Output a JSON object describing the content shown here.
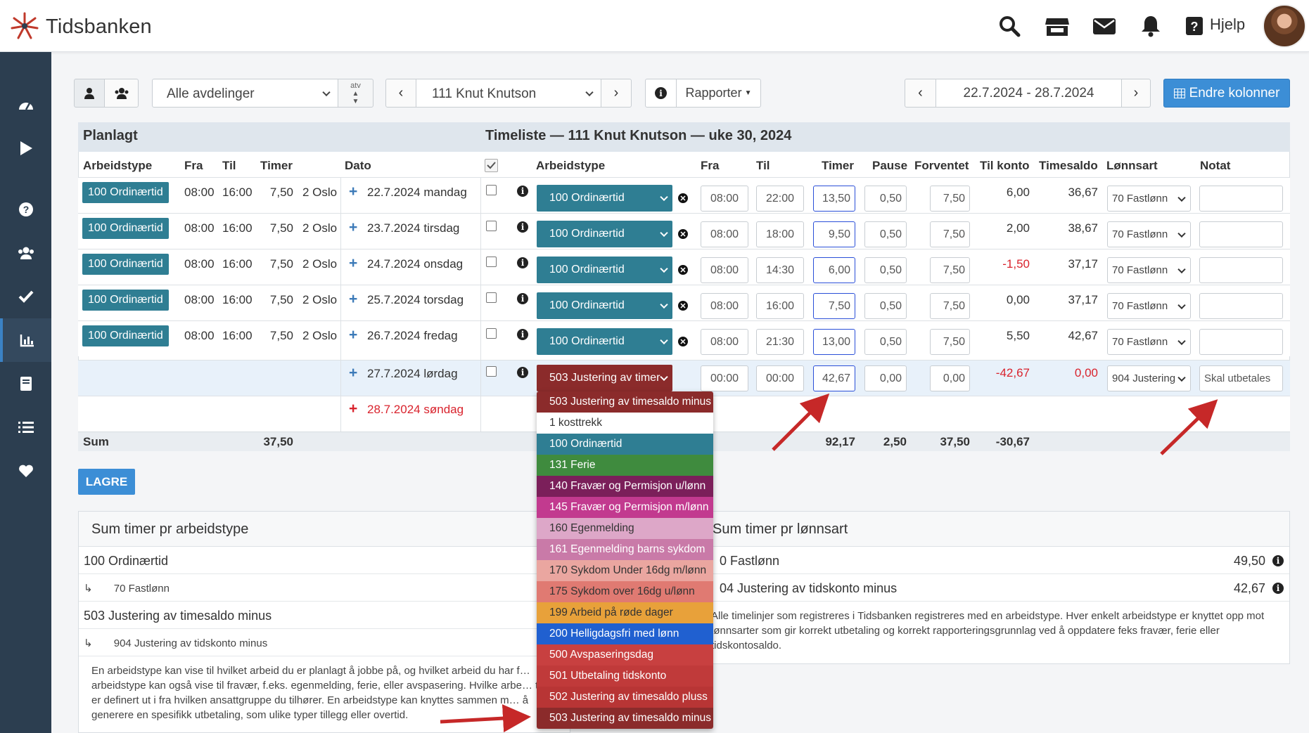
{
  "app": {
    "name": "Tidsbanken"
  },
  "header": {
    "help_label": "Hjelp"
  },
  "toolbar": {
    "department": "Alle avdelinger",
    "atv": "atv",
    "employee": "111 Knut Knutson",
    "reports_label": "Rapporter",
    "date_range": "22.7.2024 - 28.7.2024",
    "edit_columns_label": "Endre kolonner"
  },
  "panel": {
    "planned_title": "Planlagt",
    "timesheet_title": "Timeliste — 111 Knut Knutson — uke 30, 2024",
    "planned_columns": [
      "Arbeidstype",
      "Fra",
      "Til",
      "Timer"
    ],
    "date_column": "Dato",
    "columns": [
      "Arbeidstype",
      "Fra",
      "Til",
      "Timer",
      "Pause",
      "Forventet",
      "Til konto",
      "Timesaldo",
      "Lønnsart",
      "Notat"
    ],
    "rows": [
      {
        "planned_type": "100 Ordinærtid",
        "p_from": "08:00",
        "p_to": "16:00",
        "p_hours": "7,50",
        "dept": "2 Oslo",
        "date": "22.7.2024 mandag",
        "type": "100 Ordinærtid",
        "from": "08:00",
        "to": "22:00",
        "hours": "13,50",
        "pause": "0,50",
        "expected": "7,50",
        "to_account": "6,00",
        "balance": "36,67",
        "wage": "70 Fastlønn",
        "note": ""
      },
      {
        "planned_type": "100 Ordinærtid",
        "p_from": "08:00",
        "p_to": "16:00",
        "p_hours": "7,50",
        "dept": "2 Oslo",
        "date": "23.7.2024 tirsdag",
        "type": "100 Ordinærtid",
        "from": "08:00",
        "to": "18:00",
        "hours": "9,50",
        "pause": "0,50",
        "expected": "7,50",
        "to_account": "2,00",
        "balance": "38,67",
        "wage": "70 Fastlønn",
        "note": ""
      },
      {
        "planned_type": "100 Ordinærtid",
        "p_from": "08:00",
        "p_to": "16:00",
        "p_hours": "7,50",
        "dept": "2 Oslo",
        "date": "24.7.2024 onsdag",
        "type": "100 Ordinærtid",
        "from": "08:00",
        "to": "14:30",
        "hours": "6,00",
        "pause": "0,50",
        "expected": "7,50",
        "to_account": "-1,50",
        "balance": "37,17",
        "wage": "70 Fastlønn",
        "note": ""
      },
      {
        "planned_type": "100 Ordinærtid",
        "p_from": "08:00",
        "p_to": "16:00",
        "p_hours": "7,50",
        "dept": "2 Oslo",
        "date": "25.7.2024 torsdag",
        "type": "100 Ordinærtid",
        "from": "08:00",
        "to": "16:00",
        "hours": "7,50",
        "pause": "0,50",
        "expected": "7,50",
        "to_account": "0,00",
        "balance": "37,17",
        "wage": "70 Fastlønn",
        "note": ""
      },
      {
        "planned_type": "100 Ordinærtid",
        "p_from": "08:00",
        "p_to": "16:00",
        "p_hours": "7,50",
        "dept": "2 Oslo",
        "date": "26.7.2024 fredag",
        "type": "100 Ordinærtid",
        "from": "08:00",
        "to": "21:30",
        "hours": "13,00",
        "pause": "0,50",
        "expected": "7,50",
        "to_account": "5,50",
        "balance": "42,67",
        "wage": "70 Fastlønn",
        "note": ""
      },
      {
        "date": "27.7.2024 lørdag",
        "type": "503 Justering av timer",
        "from": "00:00",
        "to": "00:00",
        "hours": "42,67",
        "pause": "0,00",
        "expected": "0,00",
        "to_account": "-42,67",
        "balance": "0,00",
        "wage": "904 Justering",
        "note": "Skal utbetales"
      },
      {
        "date": "28.7.2024 søndag"
      }
    ],
    "sum": {
      "label": "Sum",
      "planned_hours": "37,50",
      "hours": "92,17",
      "pause": "2,50",
      "expected": "37,50",
      "to_account": "-30,67"
    }
  },
  "dropdown": {
    "items": [
      {
        "label": "503 Justering av timesaldo minus",
        "color": "#8b2b2b"
      },
      {
        "label": "1 kosttrekk",
        "color": "#ffffff"
      },
      {
        "label": "100 Ordinærtid",
        "color": "#2f7e93"
      },
      {
        "label": "131 Ferie",
        "color": "#3f8b3e"
      },
      {
        "label": "140 Fravær og Permisjon u/lønn",
        "color": "#7b1f5a"
      },
      {
        "label": "145 Fravær og Permisjon m/lønn",
        "color": "#c23a8f"
      },
      {
        "label": "160 Egenmelding",
        "color": "#dda7c8"
      },
      {
        "label": "161 Egenmelding barns sykdom",
        "color": "#c97aa8"
      },
      {
        "label": "170 Sykdom Under 16dg m/lønn",
        "color": "#eaa6a0"
      },
      {
        "label": "175 Sykdom over 16dg u/lønn",
        "color": "#e07a72"
      },
      {
        "label": "199 Arbeid på røde dager",
        "color": "#e8a13a"
      },
      {
        "label": "200 Helligdagsfri med lønn",
        "color": "#2060d0"
      },
      {
        "label": "500 Avspaseringsdag",
        "color": "#c84040"
      },
      {
        "label": "501 Utbetaling tidskonto",
        "color": "#c03a3a"
      },
      {
        "label": "502 Justering av timesaldo pluss",
        "color": "#b83535"
      },
      {
        "label": "503 Justering av timesaldo minus",
        "color": "#8b2b2b"
      }
    ]
  },
  "save_label": "LAGRE",
  "sum_by_type": {
    "title": "Sum timer pr arbeidstype",
    "groups": [
      {
        "label": "100 Ordinærtid",
        "sub": "70 Fastlønn"
      },
      {
        "label": "503 Justering av timesaldo minus",
        "sub": "904 Justering av tidskonto minus"
      }
    ],
    "note": "En arbeidstype kan vise til hvilket arbeid du er planlagt å jobbe på, og hvilket arbeid du har f… arbeidstype kan også vise til fravær, f.eks. egenmelding, ferie, eller avspasering. Hvilke arbe… til er definert ut i fra hvilken ansattgruppe du tilhører. En arbeidstype kan knyttes sammen m… å generere en spesifikk utbetaling, som ulike typer tillegg eller overtid."
  },
  "sum_by_wage": {
    "title": "Sum timer pr lønnsart",
    "rows": [
      {
        "label": "0 Fastlønn",
        "value": "49,50"
      },
      {
        "label": "04 Justering av tidskonto minus",
        "value": "42,67"
      }
    ],
    "note": "Alle timelinjer som registreres i Tidsbanken registreres med en arbeidstype. Hver enkelt arbeidstype er knyttet opp mot lønnsarter som gir korrekt utbetaling og korrekt rapporteringsgrunnlag ved å oppdatere feks fravær, ferie eller tidskontosaldo."
  }
}
